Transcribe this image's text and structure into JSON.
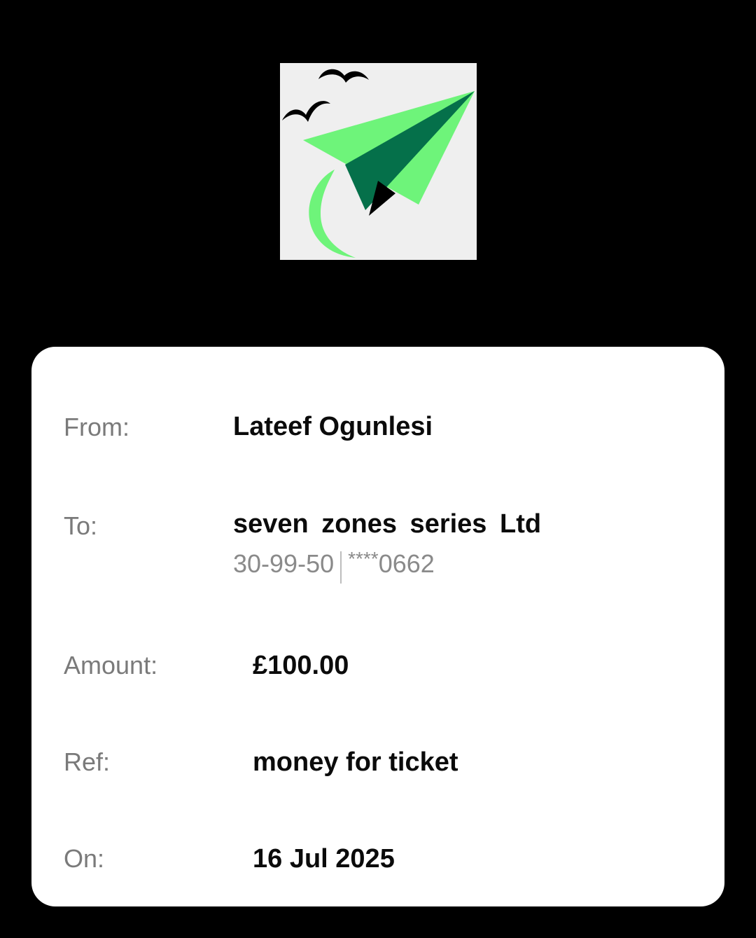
{
  "logo": {
    "name": "paper-plane-logo",
    "colors": {
      "background": "#efefef",
      "light_green": "#6ef47a",
      "dark_green": "#05704a",
      "black": "#000000"
    }
  },
  "transfer": {
    "from_label": "From:",
    "from_value": "Lateef Ogunlesi",
    "to_label": "To:",
    "to_value": "seven  zones  series  Ltd",
    "sort_code": "30-99-50",
    "account_mask": "****",
    "account_last4": "0662",
    "amount_label": "Amount:",
    "amount_value": "£100.00",
    "ref_label": "Ref:",
    "ref_value": "money for ticket",
    "on_label": "On:",
    "on_value": "16 Jul 2025"
  }
}
